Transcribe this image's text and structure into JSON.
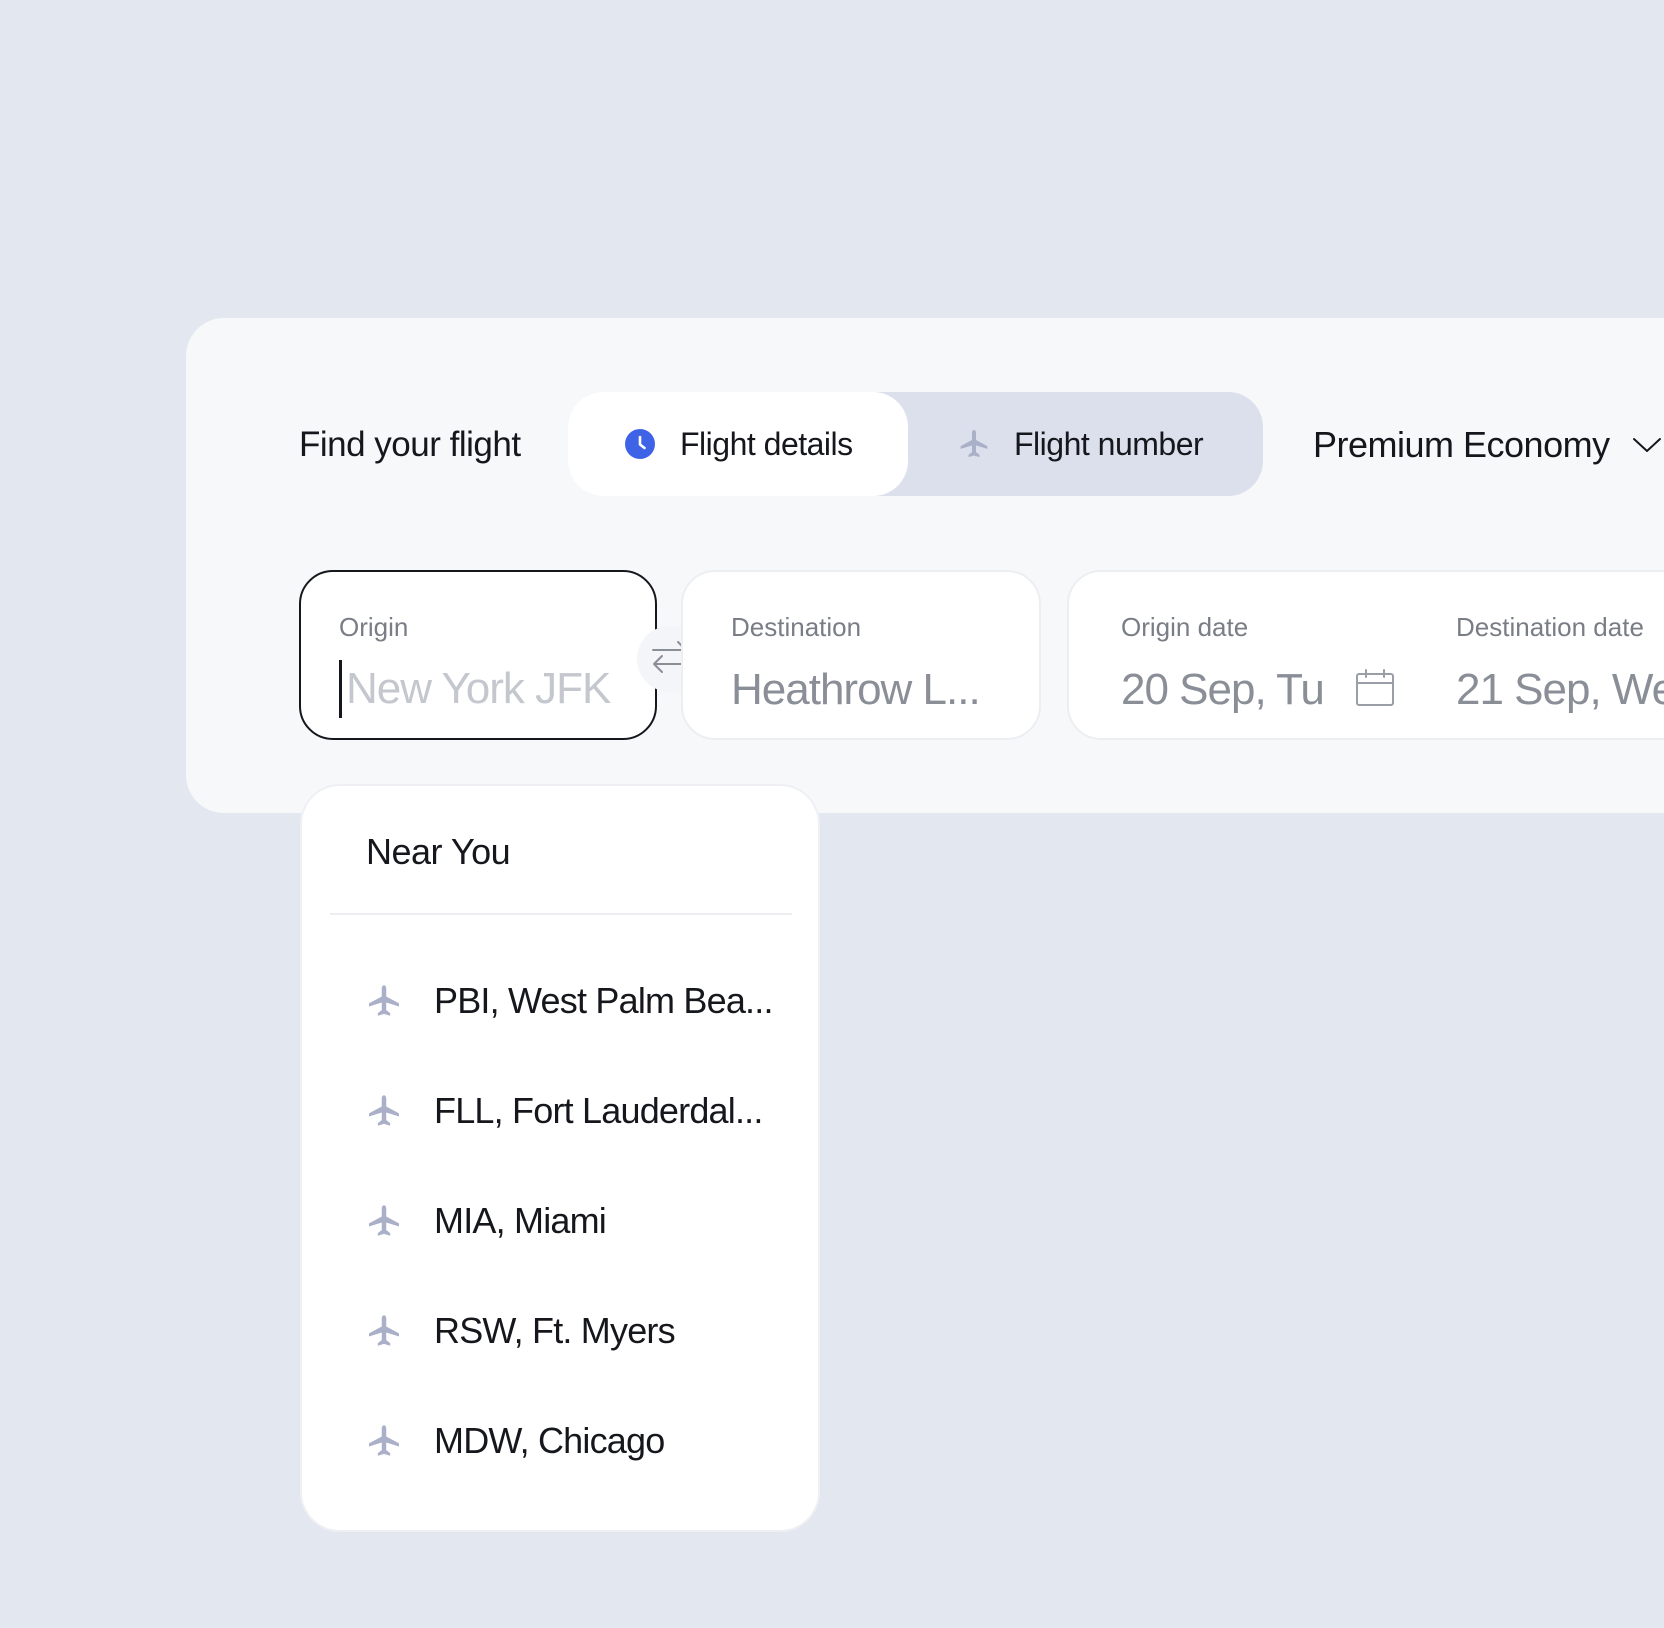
{
  "header": {
    "title": "Find your flight"
  },
  "tabs": [
    {
      "label": "Flight details",
      "icon": "clock-icon",
      "active": true
    },
    {
      "label": "Flight number",
      "icon": "plane-icon",
      "active": false
    }
  ],
  "cabin_class": {
    "selected": "Premium Economy",
    "icon": "chevron-down-icon"
  },
  "search": {
    "origin": {
      "label": "Origin",
      "value": "",
      "placeholder": "New York JFK"
    },
    "destination": {
      "label": "Destination",
      "value": "Heathrow L..."
    },
    "origin_date": {
      "label": "Origin date",
      "value": "20 Sep, Tu",
      "icon": "calendar-icon"
    },
    "destination_date": {
      "label": "Destination date",
      "value": "21 Sep, We"
    },
    "swap_icon": "swap-arrows-icon"
  },
  "dropdown": {
    "title": "Near You",
    "items": [
      {
        "label": "PBI, West Palm Bea...",
        "icon": "plane-icon"
      },
      {
        "label": "FLL, Fort Lauderdal...",
        "icon": "plane-icon"
      },
      {
        "label": "MIA, Miami",
        "icon": "plane-icon"
      },
      {
        "label": "RSW, Ft. Myers",
        "icon": "plane-icon"
      },
      {
        "label": "MDW, Chicago",
        "icon": "plane-icon"
      }
    ]
  },
  "colors": {
    "background": "#e3e7f0",
    "panel": "#f7f8fa",
    "accent": "#3f63e6",
    "icon_muted": "#aab0c8",
    "text": "#15171c"
  }
}
